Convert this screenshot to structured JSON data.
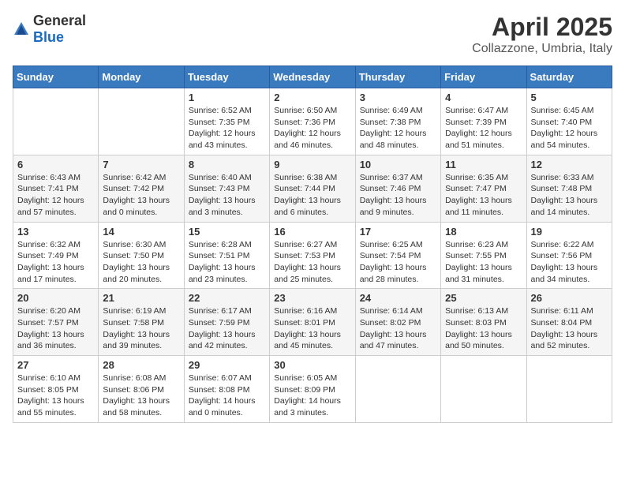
{
  "header": {
    "logo": {
      "general": "General",
      "blue": "Blue"
    },
    "title": "April 2025",
    "subtitle": "Collazzone, Umbria, Italy"
  },
  "weekdays": [
    "Sunday",
    "Monday",
    "Tuesday",
    "Wednesday",
    "Thursday",
    "Friday",
    "Saturday"
  ],
  "weeks": [
    [
      {
        "day": "",
        "info": ""
      },
      {
        "day": "",
        "info": ""
      },
      {
        "day": "1",
        "info": "Sunrise: 6:52 AM\nSunset: 7:35 PM\nDaylight: 12 hours and 43 minutes."
      },
      {
        "day": "2",
        "info": "Sunrise: 6:50 AM\nSunset: 7:36 PM\nDaylight: 12 hours and 46 minutes."
      },
      {
        "day": "3",
        "info": "Sunrise: 6:49 AM\nSunset: 7:38 PM\nDaylight: 12 hours and 48 minutes."
      },
      {
        "day": "4",
        "info": "Sunrise: 6:47 AM\nSunset: 7:39 PM\nDaylight: 12 hours and 51 minutes."
      },
      {
        "day": "5",
        "info": "Sunrise: 6:45 AM\nSunset: 7:40 PM\nDaylight: 12 hours and 54 minutes."
      }
    ],
    [
      {
        "day": "6",
        "info": "Sunrise: 6:43 AM\nSunset: 7:41 PM\nDaylight: 12 hours and 57 minutes."
      },
      {
        "day": "7",
        "info": "Sunrise: 6:42 AM\nSunset: 7:42 PM\nDaylight: 13 hours and 0 minutes."
      },
      {
        "day": "8",
        "info": "Sunrise: 6:40 AM\nSunset: 7:43 PM\nDaylight: 13 hours and 3 minutes."
      },
      {
        "day": "9",
        "info": "Sunrise: 6:38 AM\nSunset: 7:44 PM\nDaylight: 13 hours and 6 minutes."
      },
      {
        "day": "10",
        "info": "Sunrise: 6:37 AM\nSunset: 7:46 PM\nDaylight: 13 hours and 9 minutes."
      },
      {
        "day": "11",
        "info": "Sunrise: 6:35 AM\nSunset: 7:47 PM\nDaylight: 13 hours and 11 minutes."
      },
      {
        "day": "12",
        "info": "Sunrise: 6:33 AM\nSunset: 7:48 PM\nDaylight: 13 hours and 14 minutes."
      }
    ],
    [
      {
        "day": "13",
        "info": "Sunrise: 6:32 AM\nSunset: 7:49 PM\nDaylight: 13 hours and 17 minutes."
      },
      {
        "day": "14",
        "info": "Sunrise: 6:30 AM\nSunset: 7:50 PM\nDaylight: 13 hours and 20 minutes."
      },
      {
        "day": "15",
        "info": "Sunrise: 6:28 AM\nSunset: 7:51 PM\nDaylight: 13 hours and 23 minutes."
      },
      {
        "day": "16",
        "info": "Sunrise: 6:27 AM\nSunset: 7:53 PM\nDaylight: 13 hours and 25 minutes."
      },
      {
        "day": "17",
        "info": "Sunrise: 6:25 AM\nSunset: 7:54 PM\nDaylight: 13 hours and 28 minutes."
      },
      {
        "day": "18",
        "info": "Sunrise: 6:23 AM\nSunset: 7:55 PM\nDaylight: 13 hours and 31 minutes."
      },
      {
        "day": "19",
        "info": "Sunrise: 6:22 AM\nSunset: 7:56 PM\nDaylight: 13 hours and 34 minutes."
      }
    ],
    [
      {
        "day": "20",
        "info": "Sunrise: 6:20 AM\nSunset: 7:57 PM\nDaylight: 13 hours and 36 minutes."
      },
      {
        "day": "21",
        "info": "Sunrise: 6:19 AM\nSunset: 7:58 PM\nDaylight: 13 hours and 39 minutes."
      },
      {
        "day": "22",
        "info": "Sunrise: 6:17 AM\nSunset: 7:59 PM\nDaylight: 13 hours and 42 minutes."
      },
      {
        "day": "23",
        "info": "Sunrise: 6:16 AM\nSunset: 8:01 PM\nDaylight: 13 hours and 45 minutes."
      },
      {
        "day": "24",
        "info": "Sunrise: 6:14 AM\nSunset: 8:02 PM\nDaylight: 13 hours and 47 minutes."
      },
      {
        "day": "25",
        "info": "Sunrise: 6:13 AM\nSunset: 8:03 PM\nDaylight: 13 hours and 50 minutes."
      },
      {
        "day": "26",
        "info": "Sunrise: 6:11 AM\nSunset: 8:04 PM\nDaylight: 13 hours and 52 minutes."
      }
    ],
    [
      {
        "day": "27",
        "info": "Sunrise: 6:10 AM\nSunset: 8:05 PM\nDaylight: 13 hours and 55 minutes."
      },
      {
        "day": "28",
        "info": "Sunrise: 6:08 AM\nSunset: 8:06 PM\nDaylight: 13 hours and 58 minutes."
      },
      {
        "day": "29",
        "info": "Sunrise: 6:07 AM\nSunset: 8:08 PM\nDaylight: 14 hours and 0 minutes."
      },
      {
        "day": "30",
        "info": "Sunrise: 6:05 AM\nSunset: 8:09 PM\nDaylight: 14 hours and 3 minutes."
      },
      {
        "day": "",
        "info": ""
      },
      {
        "day": "",
        "info": ""
      },
      {
        "day": "",
        "info": ""
      }
    ]
  ]
}
